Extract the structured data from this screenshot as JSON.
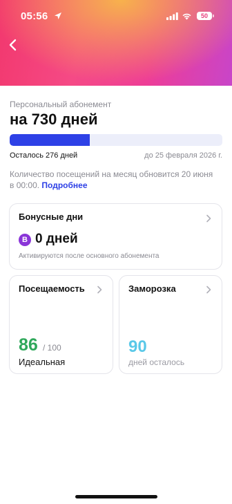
{
  "status_bar": {
    "time": "05:56",
    "battery": "50"
  },
  "header": {
    "back_icon": "chevron-left-icon"
  },
  "subscription": {
    "subtitle": "Персональный абонемент",
    "title": "на 730 дней",
    "progress_fraction": 0.378,
    "remaining": "Осталось 276 дней",
    "until": "до 25 февраля 2026 г.",
    "info": "Количество посещений на месяц обновится 20 июня в 00:00.",
    "more_link": "Подробнее"
  },
  "bonus_card": {
    "title": "Бонусные дни",
    "badge": "B",
    "value": "0 дней",
    "note": "Активируются после основного абонемента"
  },
  "visits_card": {
    "title": "Посещаемость",
    "score": "86",
    "max": "/ 100",
    "label": "Идеальная"
  },
  "freeze_card": {
    "title": "Заморозка",
    "value": "90",
    "label": "дней осталось"
  },
  "colors": {
    "accent": "#2e41e6",
    "progress_track": "#eceefa",
    "score_green": "#2fa85b",
    "freeze_blue": "#5ac8e8",
    "badge_purple": "#8a35d8"
  }
}
